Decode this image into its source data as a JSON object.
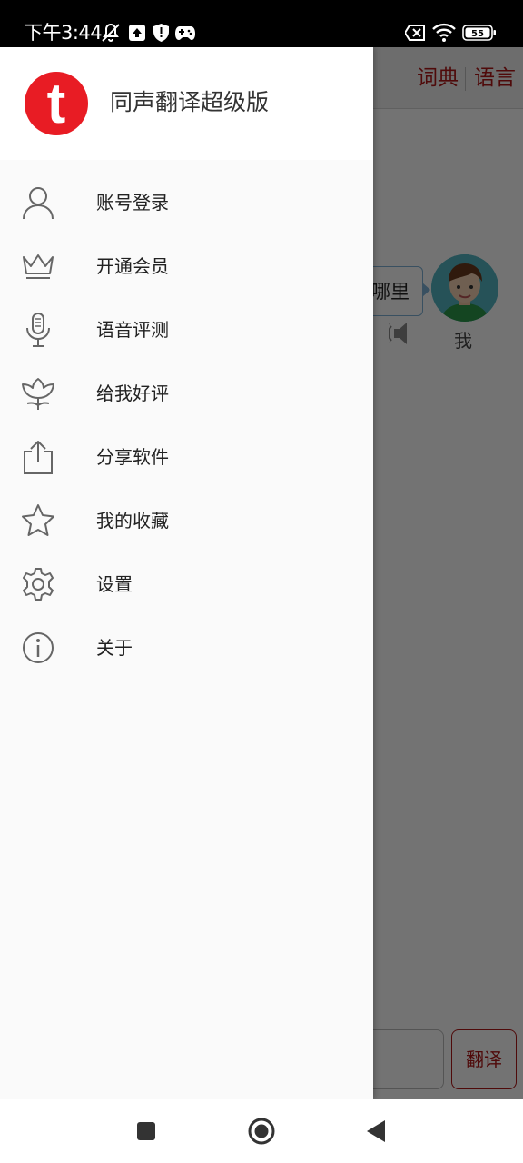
{
  "status_bar": {
    "time": "下午3:44",
    "battery": "55",
    "icons": [
      "notifications-off-icon",
      "upload-icon",
      "shield-icon",
      "gamepad-icon",
      "sim-off-icon",
      "wifi-icon",
      "battery-icon"
    ]
  },
  "background_app": {
    "tabs": [
      "词典",
      "语言"
    ],
    "bubble_text": "哪里",
    "avatar_label": "我",
    "translate_button": "翻译"
  },
  "drawer": {
    "app_name": "同声翻译超级版",
    "logo_letter": "t",
    "items": [
      {
        "label": "账号登录",
        "icon": "user-icon"
      },
      {
        "label": "开通会员",
        "icon": "crown-icon"
      },
      {
        "label": "语音评测",
        "icon": "microphone-icon"
      },
      {
        "label": "给我好评",
        "icon": "flower-icon"
      },
      {
        "label": "分享软件",
        "icon": "share-icon"
      },
      {
        "label": "我的收藏",
        "icon": "star-icon"
      },
      {
        "label": "设置",
        "icon": "gear-icon"
      },
      {
        "label": "关于",
        "icon": "info-icon"
      }
    ]
  },
  "nav_bar": {
    "buttons": [
      "recents-button",
      "home-button",
      "back-button"
    ]
  },
  "colors": {
    "accent": "#b01818",
    "logo": "#e81c24",
    "scrim": "rgba(0,0,0,0.55)"
  }
}
